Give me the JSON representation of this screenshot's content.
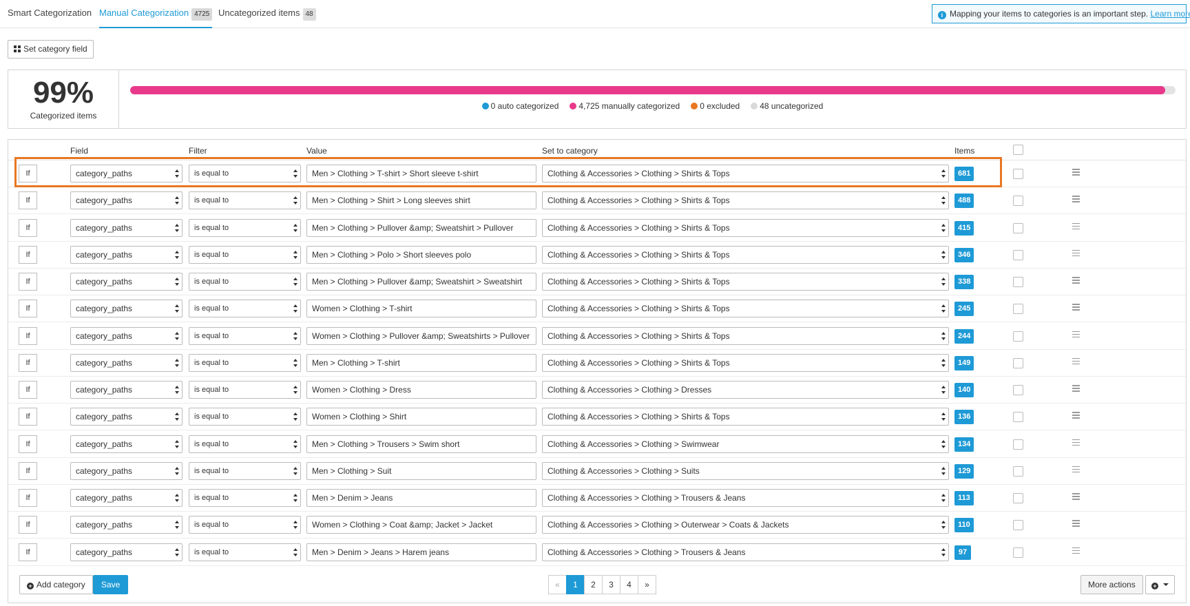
{
  "tabs": [
    {
      "label": "Smart Categorization",
      "badge": ""
    },
    {
      "label": "Manual Categorization",
      "badge": "4725"
    },
    {
      "label": "Uncategorized items",
      "badge": "48"
    }
  ],
  "notice": {
    "text": "Mapping your items to categories is an important step.",
    "link": "Learn more."
  },
  "set_category_field": "Set category field",
  "summary": {
    "percent": "99%",
    "label": "Categorized items",
    "progress_fraction": 0.99,
    "legend": [
      {
        "label": "0 auto categorized",
        "color": "#1e9ad6"
      },
      {
        "label": "4,725 manually categorized",
        "color": "#e8398b"
      },
      {
        "label": "0 excluded",
        "color": "#e87722"
      },
      {
        "label": "48 uncategorized",
        "color": "#d9d9d9"
      }
    ]
  },
  "table": {
    "headers": {
      "field": "Field",
      "filter": "Filter",
      "value": "Value",
      "category": "Set to category",
      "items": "Items"
    },
    "rows": [
      {
        "cond": "If",
        "field": "category_paths",
        "filter": "is equal to",
        "value": "Men > Clothing > T-shirt > Short sleeve t-shirt",
        "category": "Clothing & Accessories > Clothing > Shirts & Tops",
        "items": "681"
      },
      {
        "cond": "If",
        "field": "category_paths",
        "filter": "is equal to",
        "value": "Men > Clothing > Shirt > Long sleeves shirt",
        "category": "Clothing & Accessories > Clothing > Shirts & Tops",
        "items": "488"
      },
      {
        "cond": "If",
        "field": "category_paths",
        "filter": "is equal to",
        "value": "Men > Clothing > Pullover &amp; Sweatshirt > Pullover",
        "category": "Clothing & Accessories > Clothing > Shirts & Tops",
        "items": "415"
      },
      {
        "cond": "If",
        "field": "category_paths",
        "filter": "is equal to",
        "value": "Men > Clothing > Polo > Short sleeves polo",
        "category": "Clothing & Accessories > Clothing > Shirts & Tops",
        "items": "346"
      },
      {
        "cond": "If",
        "field": "category_paths",
        "filter": "is equal to",
        "value": "Men > Clothing > Pullover &amp; Sweatshirt > Sweatshirt",
        "category": "Clothing & Accessories > Clothing > Shirts & Tops",
        "items": "338"
      },
      {
        "cond": "If",
        "field": "category_paths",
        "filter": "is equal to",
        "value": "Women > Clothing > T-shirt",
        "category": "Clothing & Accessories > Clothing > Shirts & Tops",
        "items": "245"
      },
      {
        "cond": "If",
        "field": "category_paths",
        "filter": "is equal to",
        "value": "Women > Clothing > Pullover &amp; Sweatshirts > Pullover",
        "category": "Clothing & Accessories > Clothing > Shirts & Tops",
        "items": "244"
      },
      {
        "cond": "If",
        "field": "category_paths",
        "filter": "is equal to",
        "value": "Men > Clothing > T-shirt",
        "category": "Clothing & Accessories > Clothing > Shirts & Tops",
        "items": "149"
      },
      {
        "cond": "If",
        "field": "category_paths",
        "filter": "is equal to",
        "value": "Women > Clothing > Dress",
        "category": "Clothing & Accessories > Clothing > Dresses",
        "items": "140"
      },
      {
        "cond": "If",
        "field": "category_paths",
        "filter": "is equal to",
        "value": "Women > Clothing > Shirt",
        "category": "Clothing & Accessories > Clothing > Shirts & Tops",
        "items": "136"
      },
      {
        "cond": "If",
        "field": "category_paths",
        "filter": "is equal to",
        "value": "Men > Clothing > Trousers > Swim short",
        "category": "Clothing & Accessories > Clothing > Swimwear",
        "items": "134"
      },
      {
        "cond": "If",
        "field": "category_paths",
        "filter": "is equal to",
        "value": "Men > Clothing > Suit",
        "category": "Clothing & Accessories > Clothing > Suits",
        "items": "129"
      },
      {
        "cond": "If",
        "field": "category_paths",
        "filter": "is equal to",
        "value": "Men > Denim > Jeans",
        "category": "Clothing & Accessories > Clothing > Trousers & Jeans",
        "items": "113"
      },
      {
        "cond": "If",
        "field": "category_paths",
        "filter": "is equal to",
        "value": "Women > Clothing > Coat &amp; Jacket > Jacket",
        "category": "Clothing & Accessories > Clothing > Outerwear > Coats & Jackets",
        "items": "110"
      },
      {
        "cond": "If",
        "field": "category_paths",
        "filter": "is equal to",
        "value": "Men > Denim > Jeans > Harem jeans",
        "category": "Clothing & Accessories > Clothing > Trousers & Jeans",
        "items": "97"
      }
    ]
  },
  "footer": {
    "add_category": "Add category",
    "save": "Save",
    "pagination": {
      "prev": "«",
      "pages": [
        "1",
        "2",
        "3",
        "4"
      ],
      "next": "»",
      "current": "1"
    },
    "more_actions": "More actions"
  }
}
